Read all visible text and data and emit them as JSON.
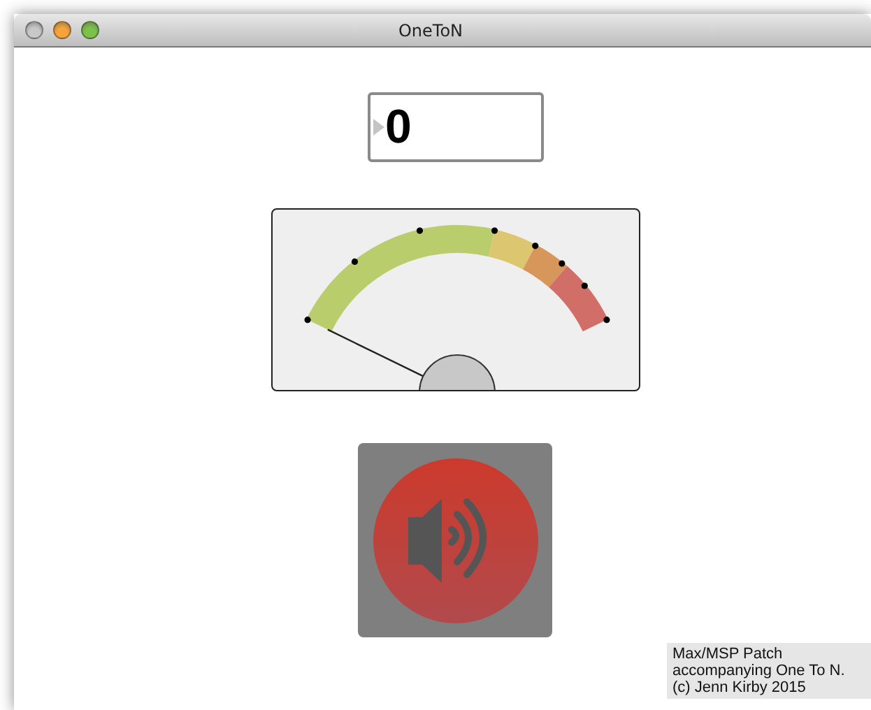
{
  "window": {
    "title": "OneToN"
  },
  "number_box": {
    "value": "0"
  },
  "speaker_button": {
    "on": true
  },
  "note": {
    "lines": [
      "Max/MSP Patch",
      "accompanying One To N.",
      "(c) Jenn Kirby 2015"
    ]
  }
}
